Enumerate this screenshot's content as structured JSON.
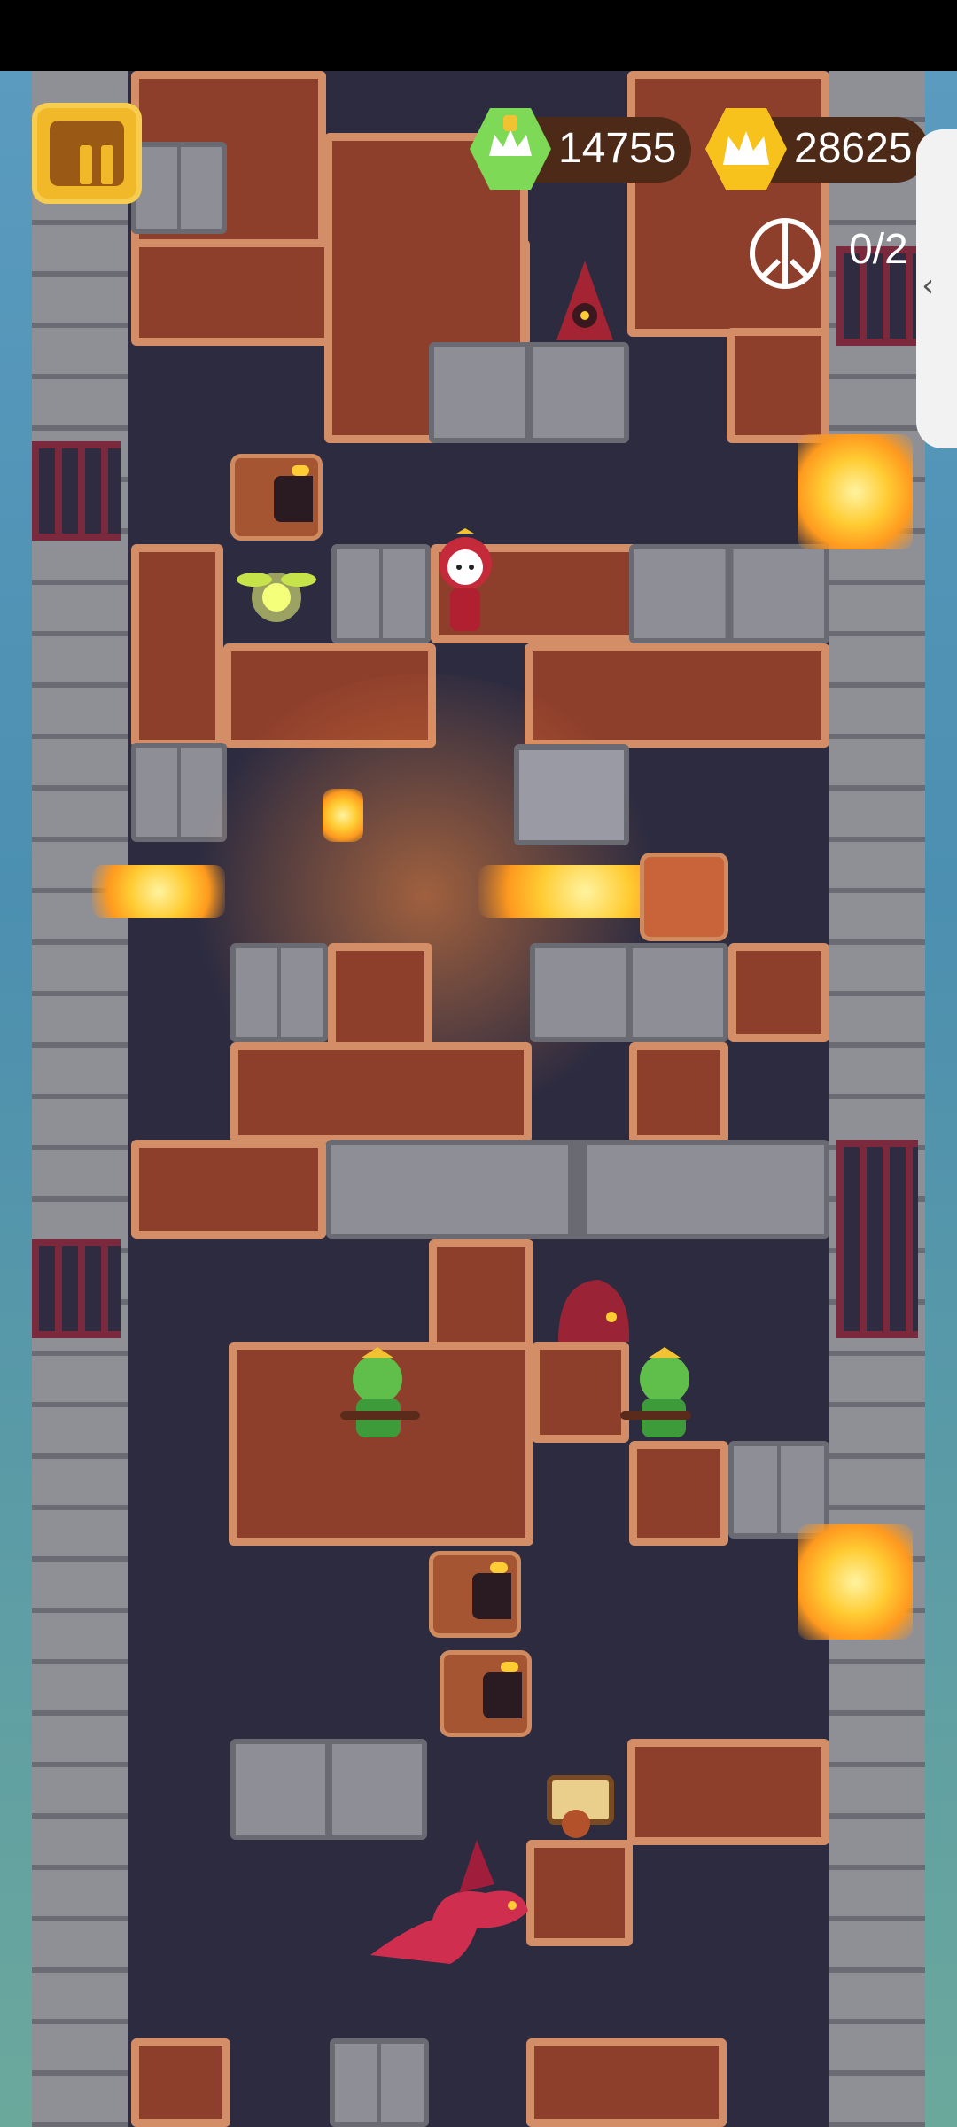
{
  "hud": {
    "pause_label": "Pause",
    "currency_green": "14755",
    "currency_gold": "28625",
    "objective_counter": "0/2",
    "side_tab_icon": "chevron-left-icon"
  },
  "colors": {
    "dirt": "#8e3f2c",
    "dirt_border": "#d38e67",
    "stone": "#8e8e96",
    "tower_bg": "#2c2b40",
    "pause_button": "#f1b82a",
    "green_badge": "#7ed957",
    "gold_badge": "#f7c21c"
  },
  "icons": {
    "green_currency": "crown-shield-icon",
    "gold_currency": "crown-icon",
    "objective": "peace-sign-icon",
    "pause": "pause-icon"
  },
  "scene": {
    "player": "hero-knight",
    "collectibles": [
      "firefly-lantern",
      "treasure-chest-top",
      "treasure-chest-bottom"
    ],
    "enemies": [
      "hooded-cultist-top",
      "red-boar-middle",
      "green-orc-left",
      "green-orc-right",
      "red-dragon"
    ],
    "traps": [
      "chomper-trap-top",
      "chomper-trap-middle-a",
      "chomper-trap-middle-b",
      "fire-spitter-right",
      "fire-spitter-left"
    ],
    "doors": [
      "metal-door"
    ]
  }
}
